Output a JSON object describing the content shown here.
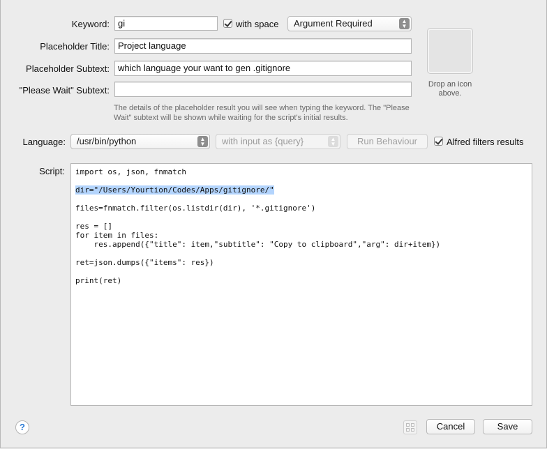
{
  "form": {
    "keyword_label": "Keyword:",
    "keyword_value": "gi",
    "with_space_label": "with space",
    "argument_option": "Argument Required",
    "placeholder_title_label": "Placeholder Title:",
    "placeholder_title_value": "Project language",
    "placeholder_subtext_label": "Placeholder Subtext:",
    "placeholder_subtext_value": "which language your want to gen .gitignore",
    "please_wait_label": "\"Please Wait\" Subtext:",
    "please_wait_value": "",
    "hint": "The details of the placeholder result you will see when typing the keyword. The \"Please Wait\" subtext will be shown while waiting for the script's initial results."
  },
  "icon_well": {
    "drop_text": "Drop an icon above."
  },
  "language": {
    "label": "Language:",
    "value": "/usr/bin/python",
    "input_mode": "with input as {query}",
    "run_behaviour": "Run Behaviour",
    "alfred_filters": "Alfred filters results"
  },
  "script": {
    "label": "Script:",
    "lines": [
      "import os, json, fnmatch",
      "",
      "dir=\"/Users/Yourtion/Codes/Apps/gitignore/\"",
      "",
      "files=fnmatch.filter(os.listdir(dir), '*.gitignore')",
      "",
      "res = []",
      "for item in files:",
      "    res.append({\"title\": item,\"subtitle\": \"Copy to clipboard\",\"arg\": dir+item})",
      "",
      "ret=json.dumps({\"items\": res})",
      "",
      "print(ret)"
    ],
    "highlighted_line": 2
  },
  "footer": {
    "help": "?",
    "cancel": "Cancel",
    "save": "Save"
  }
}
